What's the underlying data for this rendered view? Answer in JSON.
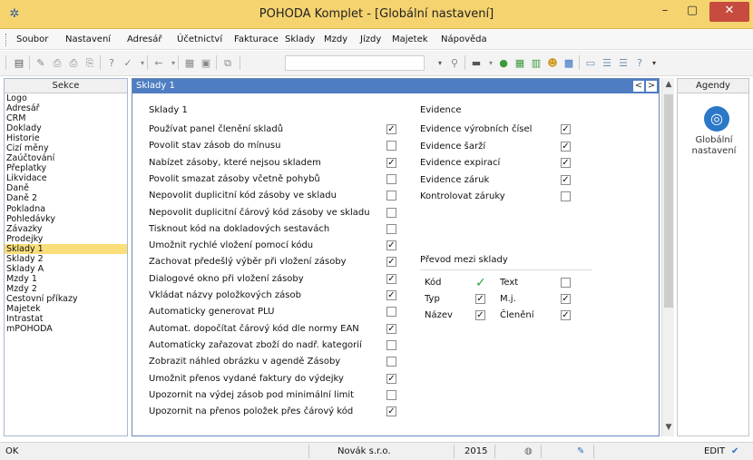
{
  "window": {
    "title": "POHODA Komplet - [Globální nastavení]",
    "app_icon": "pohoda-logo-icon"
  },
  "menu": [
    "Soubor",
    "Nastavení",
    "Adresář",
    "Účetnictví",
    "Fakturace",
    "Sklady",
    "Mzdy",
    "Jízdy",
    "Majetek",
    "Nápověda"
  ],
  "sekce": {
    "header": "Sekce",
    "items": [
      "Logo",
      "Adresář",
      "CRM",
      "Doklady",
      "Historie",
      "Cizí měny",
      "Zaúčtování",
      "Přeplatky",
      "Likvidace",
      "Daně",
      "Daně 2",
      "Pokladna",
      "Pohledávky",
      "Závazky",
      "Prodejky",
      "Sklady 1",
      "Sklady 2",
      "Sklady A",
      "Mzdy 1",
      "Mzdy 2",
      "Cestovní příkazy",
      "Majetek",
      "Intrastat",
      "mPOHODA"
    ],
    "active": "Sklady 1"
  },
  "main": {
    "header": "Sklady 1",
    "nav_prev": "<",
    "nav_next": ">",
    "left_title": "Sklady 1",
    "options": [
      {
        "label": "Používat panel členění skladů",
        "checked": true
      },
      {
        "label": "Povolit stav zásob do mínusu",
        "checked": false
      },
      {
        "label": "Nabízet zásoby, které nejsou skladem",
        "checked": true
      },
      {
        "label": "Povolit smazat zásoby včetně pohybů",
        "checked": false
      },
      {
        "label": "Nepovolit duplicitní kód zásoby ve skladu",
        "checked": false
      },
      {
        "label": "Nepovolit duplicitní čárový kód zásoby ve skladu",
        "checked": false
      },
      {
        "label": "Tisknout kód na dokladových sestavách",
        "checked": false
      },
      {
        "label": "Umožnit rychlé vložení pomocí kódu",
        "checked": true
      },
      {
        "label": "Zachovat předešlý výběr při vložení zásoby",
        "checked": true
      },
      {
        "label": "Dialogové okno při vložení zásoby",
        "checked": true
      },
      {
        "label": "Vkládat názvy položkových zásob",
        "checked": true
      },
      {
        "label": "Automaticky generovat PLU",
        "checked": false
      },
      {
        "label": "Automat. dopočítat čárový kód dle normy EAN",
        "checked": true
      },
      {
        "label": "Automaticky zařazovat zboží do nadř. kategorií",
        "checked": false
      },
      {
        "label": "Zobrazit náhled obrázku v agendě Zásoby",
        "checked": false
      },
      {
        "label": "Umožnit přenos vydané faktury do výdejky",
        "checked": true
      },
      {
        "label": "Upozornit na výdej zásob pod minimální limit",
        "checked": false
      },
      {
        "label": "Upozornit na přenos položek přes čárový kód",
        "checked": true
      }
    ],
    "evidence_title": "Evidence",
    "evidence": [
      {
        "label": "Evidence výrobních čísel",
        "checked": true
      },
      {
        "label": "Evidence šarží",
        "checked": true
      },
      {
        "label": "Evidence expirací",
        "checked": true
      },
      {
        "label": "Evidence záruk",
        "checked": true
      },
      {
        "label": "Kontrolovat záruky",
        "checked": false
      }
    ],
    "prevod_title": "Převod mezi sklady",
    "prevod_left": [
      {
        "label": "Kód",
        "checked": true,
        "style": "green-check"
      },
      {
        "label": "Typ",
        "checked": true
      },
      {
        "label": "Název",
        "checked": true
      }
    ],
    "prevod_right": [
      {
        "label": "Text",
        "checked": false
      },
      {
        "label": "M.j.",
        "checked": true
      },
      {
        "label": "Členění",
        "checked": true
      }
    ]
  },
  "agendy": {
    "header": "Agendy",
    "item_label_1": "Globální",
    "item_label_2": "nastavení",
    "item_icon": "globe-settings-icon"
  },
  "status": {
    "left": "OK",
    "company": "Novák s.r.o.",
    "year": "2015",
    "mode": "EDIT"
  },
  "colors": {
    "titlebar": "#f5d36f",
    "accent": "#4f7dc2",
    "active_item": "#f9de7a",
    "close": "#c74b3f"
  }
}
